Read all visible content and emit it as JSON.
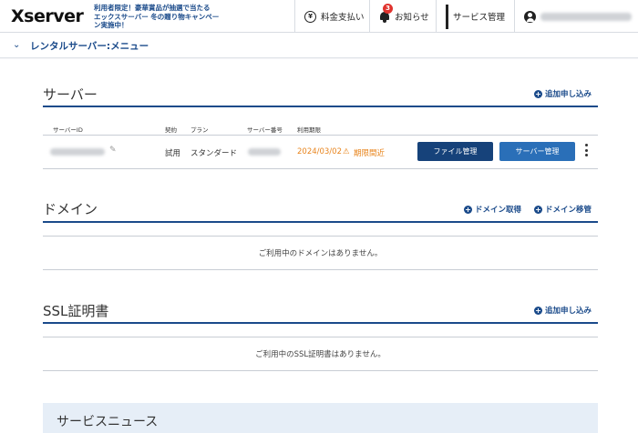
{
  "header": {
    "logo": "Xserver",
    "promo_lines": [
      "利用者限定！豪華賞品が抽選で当たる",
      "エックスサーバー 冬の贈り物キャンペー",
      "ン実施中！"
    ],
    "billing_label": "料金支払い",
    "billing_icon_glyph": "¥",
    "notifications_label": "お知らせ",
    "notification_count": "3",
    "services_label": "サービス管理"
  },
  "menu": {
    "title": "レンタルサーバー:メニュー",
    "chevron": "⌄"
  },
  "server_section": {
    "title": "サーバー",
    "add_label": "追加申し込み",
    "columns": [
      "サーバーID",
      "契約",
      "プラン",
      "サーバー番号",
      "利用期限"
    ],
    "row": {
      "contract": "試用",
      "plan": "スタンダード",
      "expiry": "2024/03/02",
      "warning": "期限間近",
      "file_button": "ファイル管理",
      "server_button": "サーバー管理"
    }
  },
  "domain_section": {
    "title": "ドメイン",
    "acquire_label": "ドメイン取得",
    "transfer_label": "ドメイン移管",
    "empty_message": "ご利用中のドメインはありません。"
  },
  "ssl_section": {
    "title": "SSL証明書",
    "add_label": "追加申し込み",
    "empty_message": "ご利用中のSSL証明書はありません。"
  },
  "news_section": {
    "title": "サービスニュース"
  },
  "colors": {
    "brand": "#1a4a8a",
    "warning": "#e8841c",
    "badge": "#e0332e"
  }
}
